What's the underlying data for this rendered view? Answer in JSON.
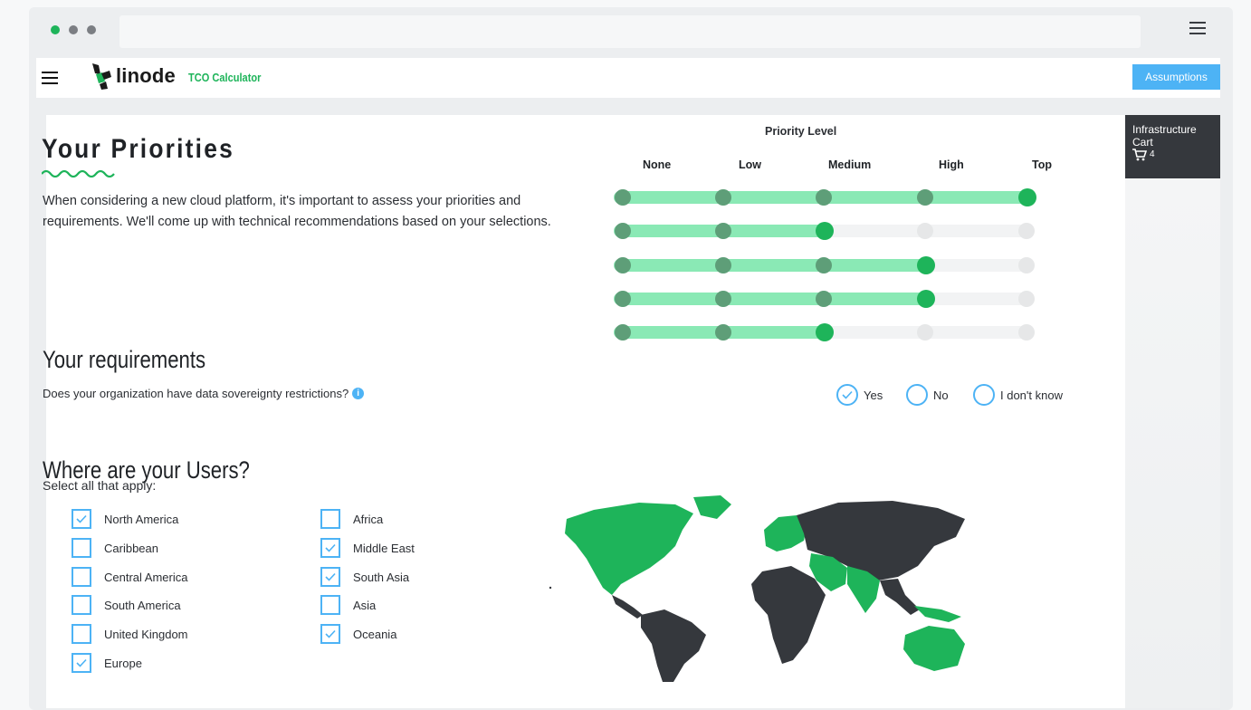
{
  "browser": {
    "dots": [
      "#1eb45a",
      "#7b7e83",
      "#7b7e83"
    ]
  },
  "header": {
    "brand": "linode",
    "product": "TCO Calculator",
    "assumptions_label": "Assumptions"
  },
  "cart": {
    "label": "Infrastructure Cart",
    "count": "4"
  },
  "priorities": {
    "title": "Your Priorities",
    "intro": "When considering a new cloud platform, it's important to assess your priorities and requirements. We'll come up with technical recommendations based on your selections.",
    "level_label": "Priority Level",
    "levels": [
      "None",
      "Low",
      "Medium",
      "High",
      "Top"
    ],
    "rows": [
      4,
      2,
      3,
      3,
      2
    ]
  },
  "requirements": {
    "title": "Your requirements",
    "question": "Does your organization have data sovereignty restrictions?",
    "options": [
      {
        "label": "Yes",
        "checked": true
      },
      {
        "label": "No",
        "checked": false
      },
      {
        "label": "I don't know",
        "checked": false
      }
    ]
  },
  "users": {
    "title": "Where are your Users?",
    "subtitle": "Select all that apply:",
    "regions": [
      {
        "label": "North America",
        "checked": true
      },
      {
        "label": "Caribbean",
        "checked": false
      },
      {
        "label": "Central America",
        "checked": false
      },
      {
        "label": "South America",
        "checked": false
      },
      {
        "label": "United Kingdom",
        "checked": false
      },
      {
        "label": "Europe",
        "checked": true
      },
      {
        "label": "Africa",
        "checked": false
      },
      {
        "label": "Middle East",
        "checked": true
      },
      {
        "label": "South Asia",
        "checked": true
      },
      {
        "label": "Asia",
        "checked": false
      },
      {
        "label": "Oceania",
        "checked": true
      }
    ]
  },
  "colors": {
    "accent_green": "#1eb45a",
    "light_green": "#8ae9b5",
    "blue": "#4db3f5",
    "dark": "#35383d"
  }
}
